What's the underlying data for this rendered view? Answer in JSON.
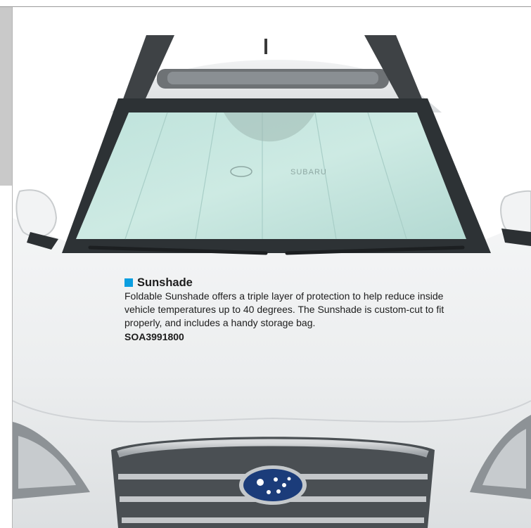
{
  "product": {
    "title": "Sunshade",
    "description": "Foldable Sunshade offers a triple layer of protection to help reduce inside vehicle temperatures up to 40 degrees. The Sunshade is custom-cut to fit properly, and includes a handy storage bag.",
    "part_number": "SOA3991800",
    "accent_color": "#0a9ee0"
  },
  "photo": {
    "windshield_brand": "SUBARU",
    "icons": [
      "subaru-badge-icon"
    ]
  }
}
